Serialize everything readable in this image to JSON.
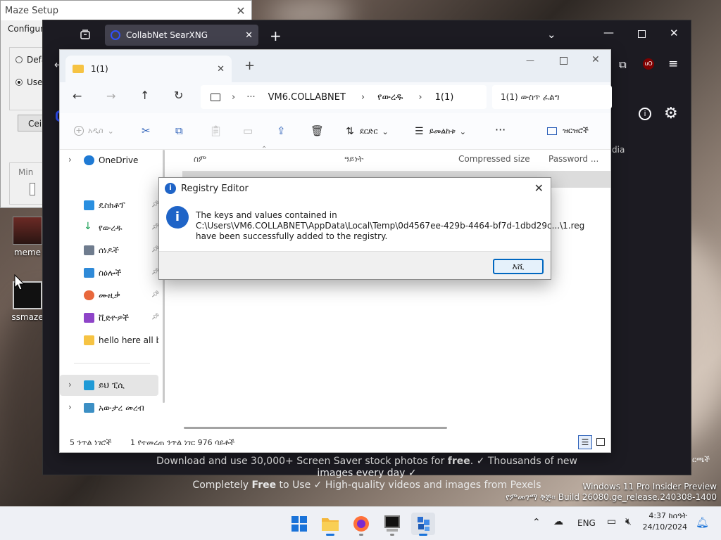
{
  "maze_setup": {
    "title": "Maze Setup",
    "group_label": "Configure",
    "option_default": "Defa",
    "option_user": "Use",
    "button_label": "Ceili",
    "min_label": "Min"
  },
  "desktop_icons": [
    {
      "label": "meme"
    },
    {
      "label": "ssmaze"
    }
  ],
  "browser": {
    "tab_title": "CollabNet SearXNG",
    "pexels_line1_pre": "Download and use 30,000+ Screen Saver stock photos for ",
    "pexels_line1_bold": "free",
    "pexels_line1_post": ". ✓ Thousands of new images every day ✓",
    "pexels_line2_pre": "Completely ",
    "pexels_line2_bold": "Free",
    "pexels_line2_post": " to Use ✓ High-quality videos and images from Pexels",
    "right_text": "dia",
    "right_text2": "ርጫች"
  },
  "explorer": {
    "tab_title": "1(1)",
    "breadcrumb": [
      "VM6.COLLABNET",
      "የውረዱ",
      "1(1)"
    ],
    "search_placeholder": "1(1) ውስጥ ፈልግ",
    "commands": {
      "new": "አዲስ",
      "sort": "ደርድር",
      "view": "ይመልከቱ",
      "details": "ዝርዝሮች"
    },
    "sidebar": [
      {
        "label": "OneDrive"
      },
      {
        "label": "ዴስክቶፕ"
      },
      {
        "label": "የውረዱ"
      },
      {
        "label": "ሰነዶች"
      },
      {
        "label": "ስዕሎች"
      },
      {
        "label": "ሙዚቃ"
      },
      {
        "label": "ቪድዮዎች"
      },
      {
        "label": "hello here all bro"
      },
      {
        "label": "ይህ ፒሲ"
      },
      {
        "label": "አውታረ መረብ"
      }
    ],
    "columns": [
      "ስም",
      "ዓይነት",
      "Compressed size",
      "Password ..."
    ],
    "status_items": "5 ንጥል ነገሮች",
    "status_selected": "1 የተመረጠ ንጥል ነገር 976 ባይቶች"
  },
  "dialog": {
    "title": "Registry Editor",
    "line1": "The keys and values contained in",
    "line2": "C:\\Users\\VM6.COLLABNET\\AppData\\Local\\Temp\\0d4567ee-429b-4464-bf7d-1dbd29c...\\1.reg",
    "line3": "have been successfully added to the registry.",
    "ok_label": "እሺ"
  },
  "watermark": {
    "line1": "Windows 11 Pro Insider Preview",
    "line2": "የምመገማ ቅጅ። Build 26080.ge_release.240308-1400"
  },
  "taskbar": {
    "lang": "ENG",
    "time": "4:37 ከሰዓት",
    "date": "24/10/2024"
  }
}
